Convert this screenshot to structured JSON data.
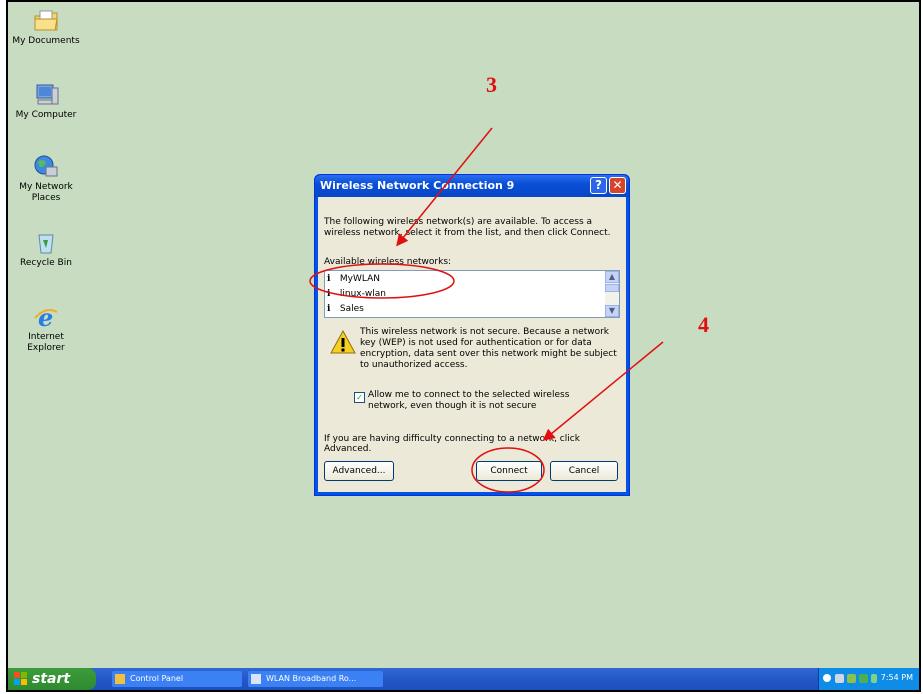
{
  "desktop": {
    "icons": [
      {
        "label": "My Documents",
        "icon": "folder-icon"
      },
      {
        "label": "My Computer",
        "icon": "computer-icon"
      },
      {
        "label": "My Network Places",
        "icon": "network-icon"
      },
      {
        "label": "Recycle Bin",
        "icon": "recycle-bin-icon"
      },
      {
        "label": "Internet Explorer",
        "icon": "internet-explorer-icon"
      }
    ]
  },
  "dialog": {
    "title": "Wireless Network Connection 9",
    "help_label": "?",
    "close_label": "✕",
    "intro": "The following wireless network(s) are available. To access a wireless network, select it from the list, and then click Connect.",
    "available_label": "Available wireless networks:",
    "networks": [
      {
        "name": "MyWLAN",
        "selected": false
      },
      {
        "name": "linux-wlan",
        "selected": false
      },
      {
        "name": "Sales",
        "selected": false
      }
    ],
    "warning": "This wireless network is not secure. Because a network key (WEP) is not used for authentication or for data encryption, data sent over this network might be subject to unauthorized access.",
    "allow_checkbox_label": "Allow me to connect to the selected wireless network, even though it is not secure",
    "allow_checked": true,
    "trouble_text": "If you are having difficulty connecting to a network, click Advanced.",
    "buttons": {
      "advanced": "Advanced...",
      "connect": "Connect",
      "cancel": "Cancel"
    }
  },
  "annotations": {
    "step3": "3",
    "step4": "4",
    "color": "#e01010"
  },
  "taskbar": {
    "start_label": "start",
    "tasks": [
      {
        "label": "Control Panel"
      },
      {
        "label": "WLAN Broadband Ro..."
      }
    ],
    "clock": "7:54 PM"
  },
  "colors": {
    "desktop": "#c7dcc0",
    "titlebar": "#0054e3",
    "taskbar": "#245edb",
    "start": "#3c9c3c"
  }
}
